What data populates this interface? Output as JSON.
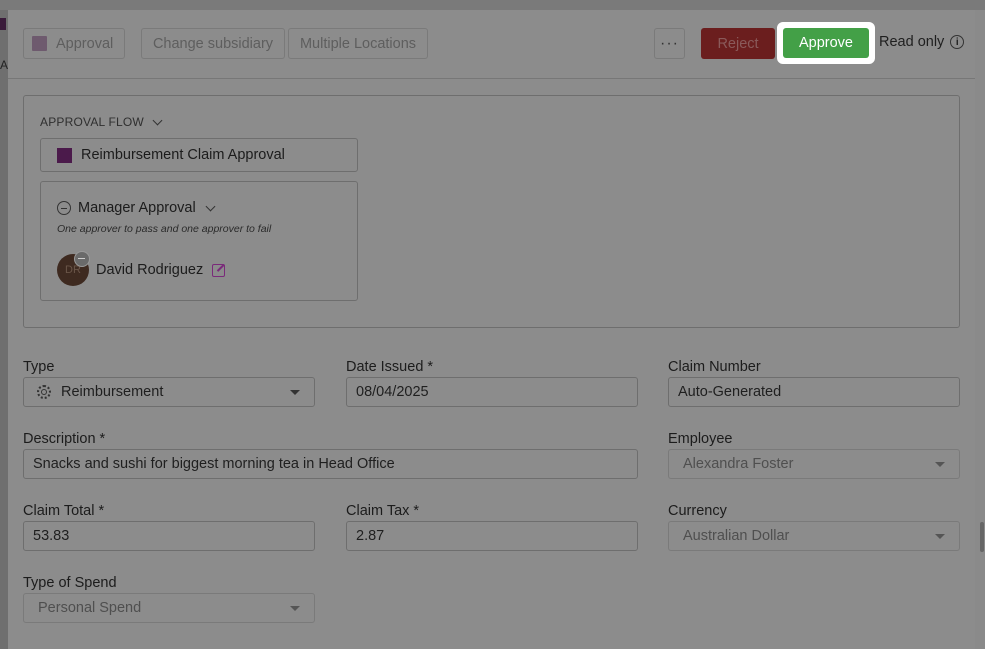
{
  "toolbar": {
    "approval_label": "Approval",
    "change_subsidiary_label": "Change subsidiary",
    "multiple_locations_label": "Multiple Locations",
    "more_label": "···",
    "reject_label": "Reject",
    "approve_label": "Approve",
    "readonly_label": "Read only",
    "info_icon": "i"
  },
  "background": {
    "letter": "A"
  },
  "approval_flow": {
    "title": "APPROVAL FLOW",
    "flow_name": "Reimbursement Claim Approval",
    "step": {
      "name": "Manager Approval",
      "rule": "One approver to pass and one approver to fail",
      "approver_initials": "DR",
      "approver_name": "David Rodriguez"
    }
  },
  "form": {
    "type": {
      "label": "Type",
      "value": "Reimbursement"
    },
    "date_issued": {
      "label": "Date Issued *",
      "value": "08/04/2025"
    },
    "claim_number": {
      "label": "Claim Number",
      "value": "Auto-Generated"
    },
    "description": {
      "label": "Description *",
      "value": "Snacks and sushi for biggest morning tea in Head Office"
    },
    "employee": {
      "label": "Employee",
      "value": "Alexandra Foster"
    },
    "claim_total": {
      "label": "Claim Total *",
      "value": "53.83"
    },
    "claim_tax": {
      "label": "Claim Tax *",
      "value": "2.87"
    },
    "currency": {
      "label": "Currency",
      "value": "Australian Dollar"
    },
    "type_of_spend": {
      "label": "Type of Spend",
      "value": "Personal Spend"
    }
  },
  "colors": {
    "approve": "#43a047",
    "reject": "#6b1e1e",
    "flow_swatch": "#4b1a4b"
  }
}
